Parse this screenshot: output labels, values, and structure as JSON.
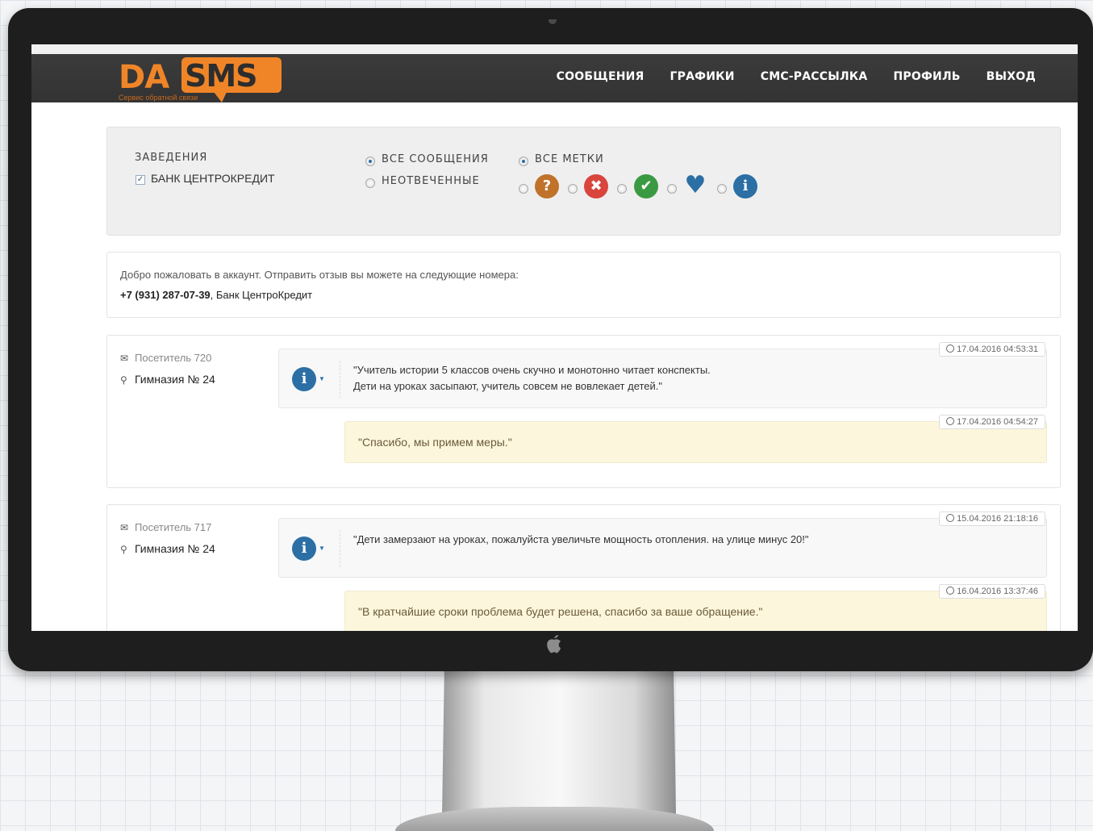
{
  "brand": {
    "logo_left": "DA",
    "logo_right": "SMS",
    "tagline": "Сервис обратной связи",
    "accent": "#f08528"
  },
  "nav": {
    "items": [
      "СООБЩЕНИЯ",
      "ГРАФИКИ",
      "СМС-РАССЫЛКА",
      "ПРОФИЛЬ",
      "ВЫХОД"
    ]
  },
  "filters": {
    "venues_label": "ЗАВЕДЕНИЯ",
    "venue_option": "БАНК ЦЕНТРОКРЕДИТ",
    "venue_checked": true,
    "messages_all": "ВСЕ СООБЩЕНИЯ",
    "messages_unanswered": "НЕОТВЕЧЕННЫЕ",
    "tags_all": "ВСЕ МЕТКИ",
    "tag_icons": [
      "question-icon",
      "cross-icon",
      "check-icon",
      "heart-icon",
      "info-icon"
    ]
  },
  "welcome": {
    "line1": "Добро пожаловать в аккаунт. Отправить отзыв вы можете на следующие номера:",
    "phone": "+7 (931) 287-07-39",
    "bank": ", Банк ЦентроКредит"
  },
  "messages": [
    {
      "visitor": "Посетитель 720",
      "place": "Гимназия № 24",
      "time": "17.04.2016 04:53:31",
      "text_line1": "\"Учитель истории 5 классов очень скучно и монотонно читает конспекты.",
      "text_line2": "Дети на уроках засыпают, учитель совсем не вовлекает детей.\"",
      "reply_time": "17.04.2016 04:54:27",
      "reply": "\"Спасибо, мы примем меры.\""
    },
    {
      "visitor": "Посетитель 717",
      "place": "Гимназия № 24",
      "time": "15.04.2016 21:18:16",
      "text_line1": "\"Дети замерзают на уроках, пожалуйста увеличьте мощность отопления. на улице минус 20!\"",
      "text_line2": "",
      "reply_time": "16.04.2016 13:37:46",
      "reply": "\"В кратчайшие сроки проблема будет решена, спасибо за ваше обращение.\""
    }
  ]
}
